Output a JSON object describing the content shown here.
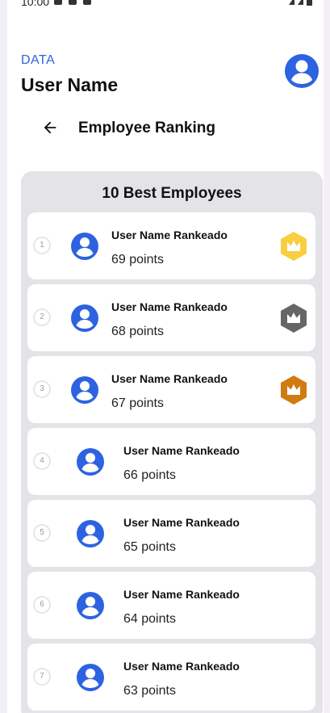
{
  "status_bar": {
    "time": "10:00"
  },
  "header": {
    "section_label": "DATA",
    "user_name": "User Name",
    "avatar_icon": "account-circle-icon",
    "accent_color": "#2d63e0"
  },
  "toolbar": {
    "back_icon": "arrow-back-icon",
    "title": "Employee Ranking"
  },
  "ranking": {
    "title": "10 Best Employees",
    "items": [
      {
        "rank": "1",
        "name": "User Name Rankeado",
        "points": "69 points",
        "badge": "gold-crown-icon",
        "badge_color": "#f9cf40"
      },
      {
        "rank": "2",
        "name": "User Name Rankeado",
        "points": "68 points",
        "badge": "silver-crown-icon",
        "badge_color": "#666666"
      },
      {
        "rank": "3",
        "name": "User Name Rankeado",
        "points": "67 points",
        "badge": "bronze-crown-icon",
        "badge_color": "#d07a10"
      },
      {
        "rank": "4",
        "name": "User Name Rankeado",
        "points": "66 points"
      },
      {
        "rank": "5",
        "name": "User Name Rankeado",
        "points": "65 points"
      },
      {
        "rank": "6",
        "name": "User Name Rankeado",
        "points": "64 points"
      },
      {
        "rank": "7",
        "name": "User Name Rankeado",
        "points": "63 points"
      }
    ]
  }
}
